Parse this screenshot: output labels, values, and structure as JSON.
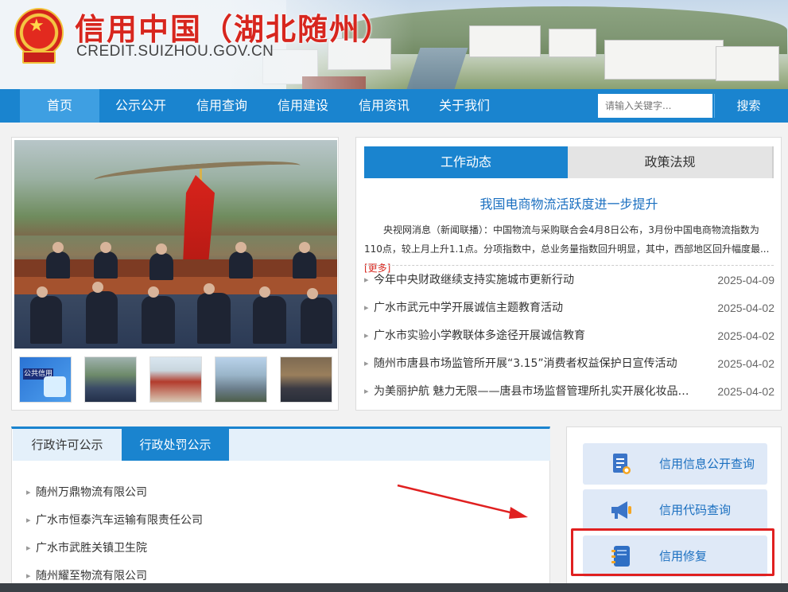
{
  "header": {
    "site_title": "信用中国（湖北随州）",
    "site_domain": "CREDIT.SUIZHOU.GOV.CN"
  },
  "nav": {
    "items": [
      {
        "label": "首页",
        "active": true
      },
      {
        "label": "公示公开"
      },
      {
        "label": "信用查询"
      },
      {
        "label": "信用建设"
      },
      {
        "label": "信用资讯"
      },
      {
        "label": "关于我们"
      }
    ],
    "search_placeholder": "请输入关键字...",
    "search_button": "搜索"
  },
  "carousel": {
    "thumb_1_badge": "公共信用"
  },
  "news": {
    "tabs": [
      {
        "label": "工作动态",
        "active": true
      },
      {
        "label": "政策法规"
      }
    ],
    "headline": "我国电商物流活跃度进一步提升",
    "summary": "央视网消息（新闻联播）：中国物流与采购联合会4月8日公布，3月份中国电商物流指数为110点，较上月上升1.1点。分项指数中，总业务量指数回升明显，其中，西部地区回升幅度最...",
    "more_label": "[更多]",
    "items": [
      {
        "title": "今年中央财政继续支持实施城市更新行动",
        "date": "2025-04-09"
      },
      {
        "title": "广水市武元中学开展诚信主题教育活动",
        "date": "2025-04-02"
      },
      {
        "title": "广水市实验小学教联体多途径开展诚信教育",
        "date": "2025-04-02"
      },
      {
        "title": "随州市唐县市场监管所开展“3.15”消费者权益保护日宣传活动",
        "date": "2025-04-02"
      },
      {
        "title": "为美丽护航 魅力无限——唐县市场监督管理所扎实开展化妆品监...",
        "date": "2025-04-02"
      }
    ]
  },
  "notices": {
    "tabs": [
      {
        "label": "行政许可公示"
      },
      {
        "label": "行政处罚公示",
        "active": true
      }
    ],
    "companies": [
      "随州万鼎物流有限公司",
      "广水市恒泰汽车运输有限责任公司",
      "广水市武胜关镇卫生院",
      "随州耀至物流有限公司"
    ]
  },
  "services": [
    {
      "label": "信用信息公开查询",
      "icon": "document-search-icon"
    },
    {
      "label": "信用代码查询",
      "icon": "megaphone-icon"
    },
    {
      "label": "信用修复",
      "icon": "notebook-icon",
      "highlighted": true
    }
  ],
  "colors": {
    "primary": "#1a84cf",
    "title_red": "#d7261e",
    "link_blue": "#1a6fc0",
    "highlight_red": "#e02020"
  }
}
